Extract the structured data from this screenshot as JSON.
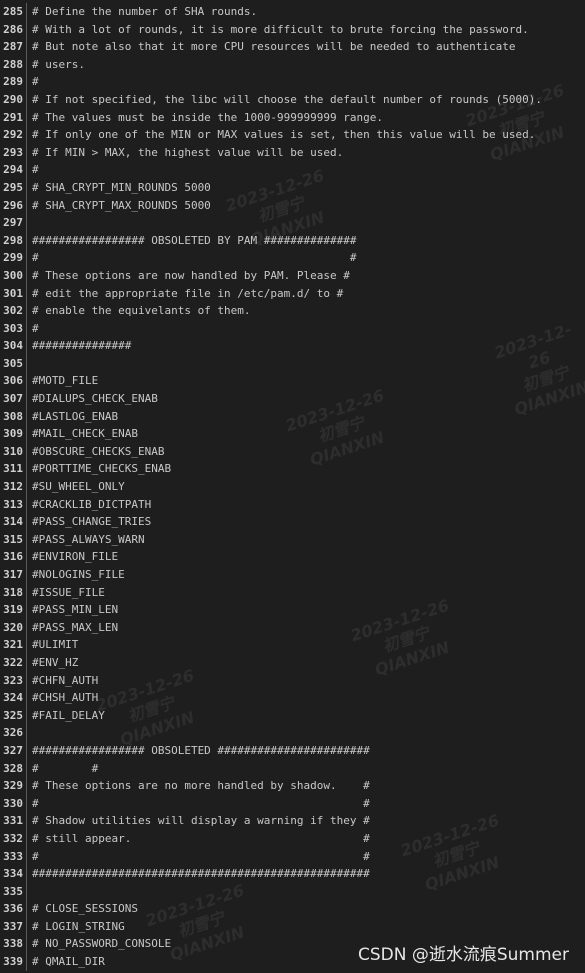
{
  "editor": {
    "lines": [
      {
        "n": "285",
        "text": "# Define the number of SHA rounds."
      },
      {
        "n": "286",
        "text": "# With a lot of rounds, it is more difficult to brute forcing the password."
      },
      {
        "n": "287",
        "text": "# But note also that it more CPU resources will be needed to authenticate"
      },
      {
        "n": "288",
        "text": "# users."
      },
      {
        "n": "289",
        "text": "#"
      },
      {
        "n": "290",
        "text": "# If not specified, the libc will choose the default number of rounds (5000)."
      },
      {
        "n": "291",
        "text": "# The values must be inside the 1000-999999999 range."
      },
      {
        "n": "292",
        "text": "# If only one of the MIN or MAX values is set, then this value will be used."
      },
      {
        "n": "293",
        "text": "# If MIN > MAX, the highest value will be used."
      },
      {
        "n": "294",
        "text": "#"
      },
      {
        "n": "295",
        "text": "# SHA_CRYPT_MIN_ROUNDS 5000"
      },
      {
        "n": "296",
        "text": "# SHA_CRYPT_MAX_ROUNDS 5000"
      },
      {
        "n": "297",
        "text": ""
      },
      {
        "n": "298",
        "text": "################# OBSOLETED BY PAM ##############"
      },
      {
        "n": "299",
        "text": "#                                               #"
      },
      {
        "n": "300",
        "text": "# These options are now handled by PAM. Please #"
      },
      {
        "n": "301",
        "text": "# edit the appropriate file in /etc/pam.d/ to #"
      },
      {
        "n": "302",
        "text": "# enable the equivelants of them."
      },
      {
        "n": "303",
        "text": "#"
      },
      {
        "n": "304",
        "text": "###############"
      },
      {
        "n": "305",
        "text": ""
      },
      {
        "n": "306",
        "text": "#MOTD_FILE"
      },
      {
        "n": "307",
        "text": "#DIALUPS_CHECK_ENAB"
      },
      {
        "n": "308",
        "text": "#LASTLOG_ENAB"
      },
      {
        "n": "309",
        "text": "#MAIL_CHECK_ENAB"
      },
      {
        "n": "310",
        "text": "#OBSCURE_CHECKS_ENAB"
      },
      {
        "n": "311",
        "text": "#PORTTIME_CHECKS_ENAB"
      },
      {
        "n": "312",
        "text": "#SU_WHEEL_ONLY"
      },
      {
        "n": "313",
        "text": "#CRACKLIB_DICTPATH"
      },
      {
        "n": "314",
        "text": "#PASS_CHANGE_TRIES"
      },
      {
        "n": "315",
        "text": "#PASS_ALWAYS_WARN"
      },
      {
        "n": "316",
        "text": "#ENVIRON_FILE"
      },
      {
        "n": "317",
        "text": "#NOLOGINS_FILE"
      },
      {
        "n": "318",
        "text": "#ISSUE_FILE"
      },
      {
        "n": "319",
        "text": "#PASS_MIN_LEN"
      },
      {
        "n": "320",
        "text": "#PASS_MAX_LEN"
      },
      {
        "n": "321",
        "text": "#ULIMIT"
      },
      {
        "n": "322",
        "text": "#ENV_HZ"
      },
      {
        "n": "323",
        "text": "#CHFN_AUTH"
      },
      {
        "n": "324",
        "text": "#CHSH_AUTH"
      },
      {
        "n": "325",
        "text": "#FAIL_DELAY"
      },
      {
        "n": "326",
        "text": ""
      },
      {
        "n": "327",
        "text": "################# OBSOLETED #######################"
      },
      {
        "n": "328",
        "text": "#        #"
      },
      {
        "n": "329",
        "text": "# These options are no more handled by shadow.    #"
      },
      {
        "n": "330",
        "text": "#                                                 #"
      },
      {
        "n": "331",
        "text": "# Shadow utilities will display a warning if they #"
      },
      {
        "n": "332",
        "text": "# still appear.                                   #"
      },
      {
        "n": "333",
        "text": "#                                                 #"
      },
      {
        "n": "334",
        "text": "###################################################"
      },
      {
        "n": "335",
        "text": ""
      },
      {
        "n": "336",
        "text": "# CLOSE_SESSIONS"
      },
      {
        "n": "337",
        "text": "# LOGIN_STRING"
      },
      {
        "n": "338",
        "text": "# NO_PASSWORD_CONSOLE"
      },
      {
        "n": "339",
        "text": "# QMAIL_DIR"
      }
    ]
  },
  "watermark": {
    "date": "2023-12-26",
    "name": "初雪宁",
    "latin": "QIANXIN"
  },
  "credit": "CSDN @逝水流痕Summer"
}
